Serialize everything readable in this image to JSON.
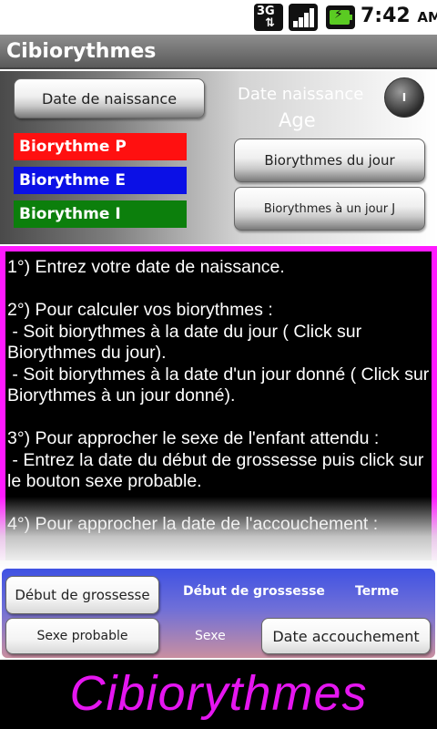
{
  "status_bar": {
    "network": {
      "top": "3G",
      "bottom": "⇅"
    },
    "time": "7:42",
    "ampm": "AM",
    "icons": [
      "3g-icon",
      "signal-icon",
      "battery-charging-icon"
    ]
  },
  "app": {
    "title": "Cibiorythmes"
  },
  "top_panel": {
    "birth_button": "Date de naissance",
    "birth_date_label": "Date naissance",
    "age_label": "Age",
    "info_button": "I",
    "biorhythms": [
      {
        "label": "Biorythme P",
        "color": "#ff1010"
      },
      {
        "label": "Biorythme E",
        "color": "#0b10e6"
      },
      {
        "label": "Biorythme I",
        "color": "#0c7f0c"
      }
    ],
    "today_button": "Biorythmes du jour",
    "day_j_button": "Biorythmes à un jour J"
  },
  "instructions": {
    "text": "1°) Entrez votre date de naissance.\n\n2°) Pour calculer vos biorythmes :\n - Soit biorythmes à la date du jour ( Click sur Biorythmes du jour).\n - Soit biorythmes à la date d'un jour donné ( Click sur Biorythmes à un jour donné).\n\n3°) Pour approcher le sexe de l'enfant attendu :\n - Entrez la date du début de grossesse puis click sur le bouton sexe probable.\n\n4°) Pour approcher la date de l'accouchement :",
    "border_color": "#ff1aff"
  },
  "bottom_panel": {
    "pregnancy_start_button": "Début de grossesse",
    "pregnancy_start_label": "Début de grossesse",
    "term_label": "Terme",
    "probable_sex_button": "Sexe probable",
    "sex_label": "Sexe",
    "delivery_date_button": "Date accouchement"
  },
  "banner": {
    "text": "Cibiorythmes",
    "color": "#e516f0"
  }
}
